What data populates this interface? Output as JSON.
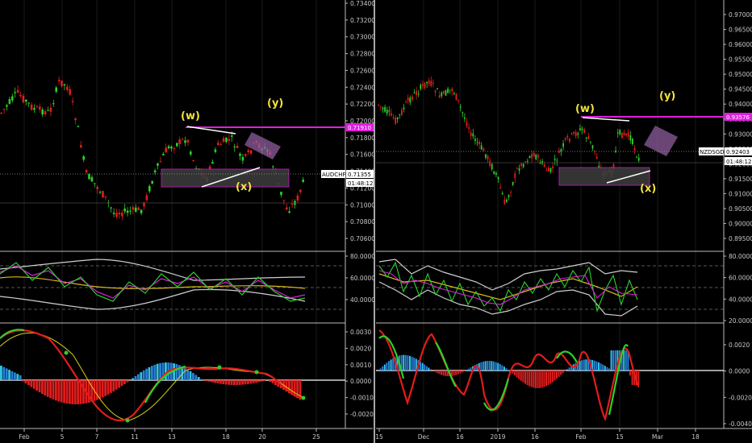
{
  "colors": {
    "background": "#000000",
    "bull": "#2bd12b",
    "bear": "#e31c1c",
    "magenta": "#e01ee0",
    "wave_label": "#f2e33a",
    "zone_fill": "#3a3a3a",
    "zone_border": "#c01bc0",
    "divider": "#bbbbbb"
  },
  "panels": [
    {
      "id": "left",
      "symbol": "AUDCHF",
      "price_label": "0.71355",
      "countdown": "01:48:12",
      "level_label": "0.71910",
      "y_ticks": [
        "0.73400",
        "0.73200",
        "0.73000",
        "0.72800",
        "0.72600",
        "0.72400",
        "0.72200",
        "0.72000",
        "0.71800",
        "0.71600",
        "0.71400",
        "0.71200",
        "0.71000",
        "0.70800",
        "0.70600"
      ],
      "rsi_ticks": [
        "80.0000",
        "60.0000",
        "40.0000"
      ],
      "macd_ticks": [
        "0.0030",
        "0.0020",
        "0.0010",
        "0.0000",
        "-0.0010",
        "-0.0020"
      ],
      "x_labels": [
        "Feb",
        "5",
        "7",
        "11",
        "13",
        "18",
        "20",
        "25"
      ],
      "waves": [
        "(w)",
        "(x)",
        "(y)"
      ]
    },
    {
      "id": "right",
      "symbol": "NZDSGD",
      "price_label": "0.92403",
      "countdown": "01:48:12",
      "level_label": "0.93576",
      "y_ticks": [
        "0.97000",
        "0.96500",
        "0.96000",
        "0.95500",
        "0.95000",
        "0.94500",
        "0.94000",
        "0.93500",
        "0.93000",
        "0.92500",
        "0.92000",
        "0.91500",
        "0.91000",
        "0.90500",
        "0.90000",
        "0.89500"
      ],
      "rsi_ticks": [
        "80.0000",
        "60.0000",
        "40.0000",
        "20.0000"
      ],
      "macd_ticks": [
        "0.0020",
        "0.0000",
        "-0.0020",
        "-0.0040"
      ],
      "x_labels": [
        "15",
        "Dec",
        "16",
        "2019",
        "16",
        "Feb",
        "15",
        "Mar",
        "18"
      ],
      "waves": [
        "(w)",
        "(x)",
        "(y)"
      ]
    }
  ]
}
